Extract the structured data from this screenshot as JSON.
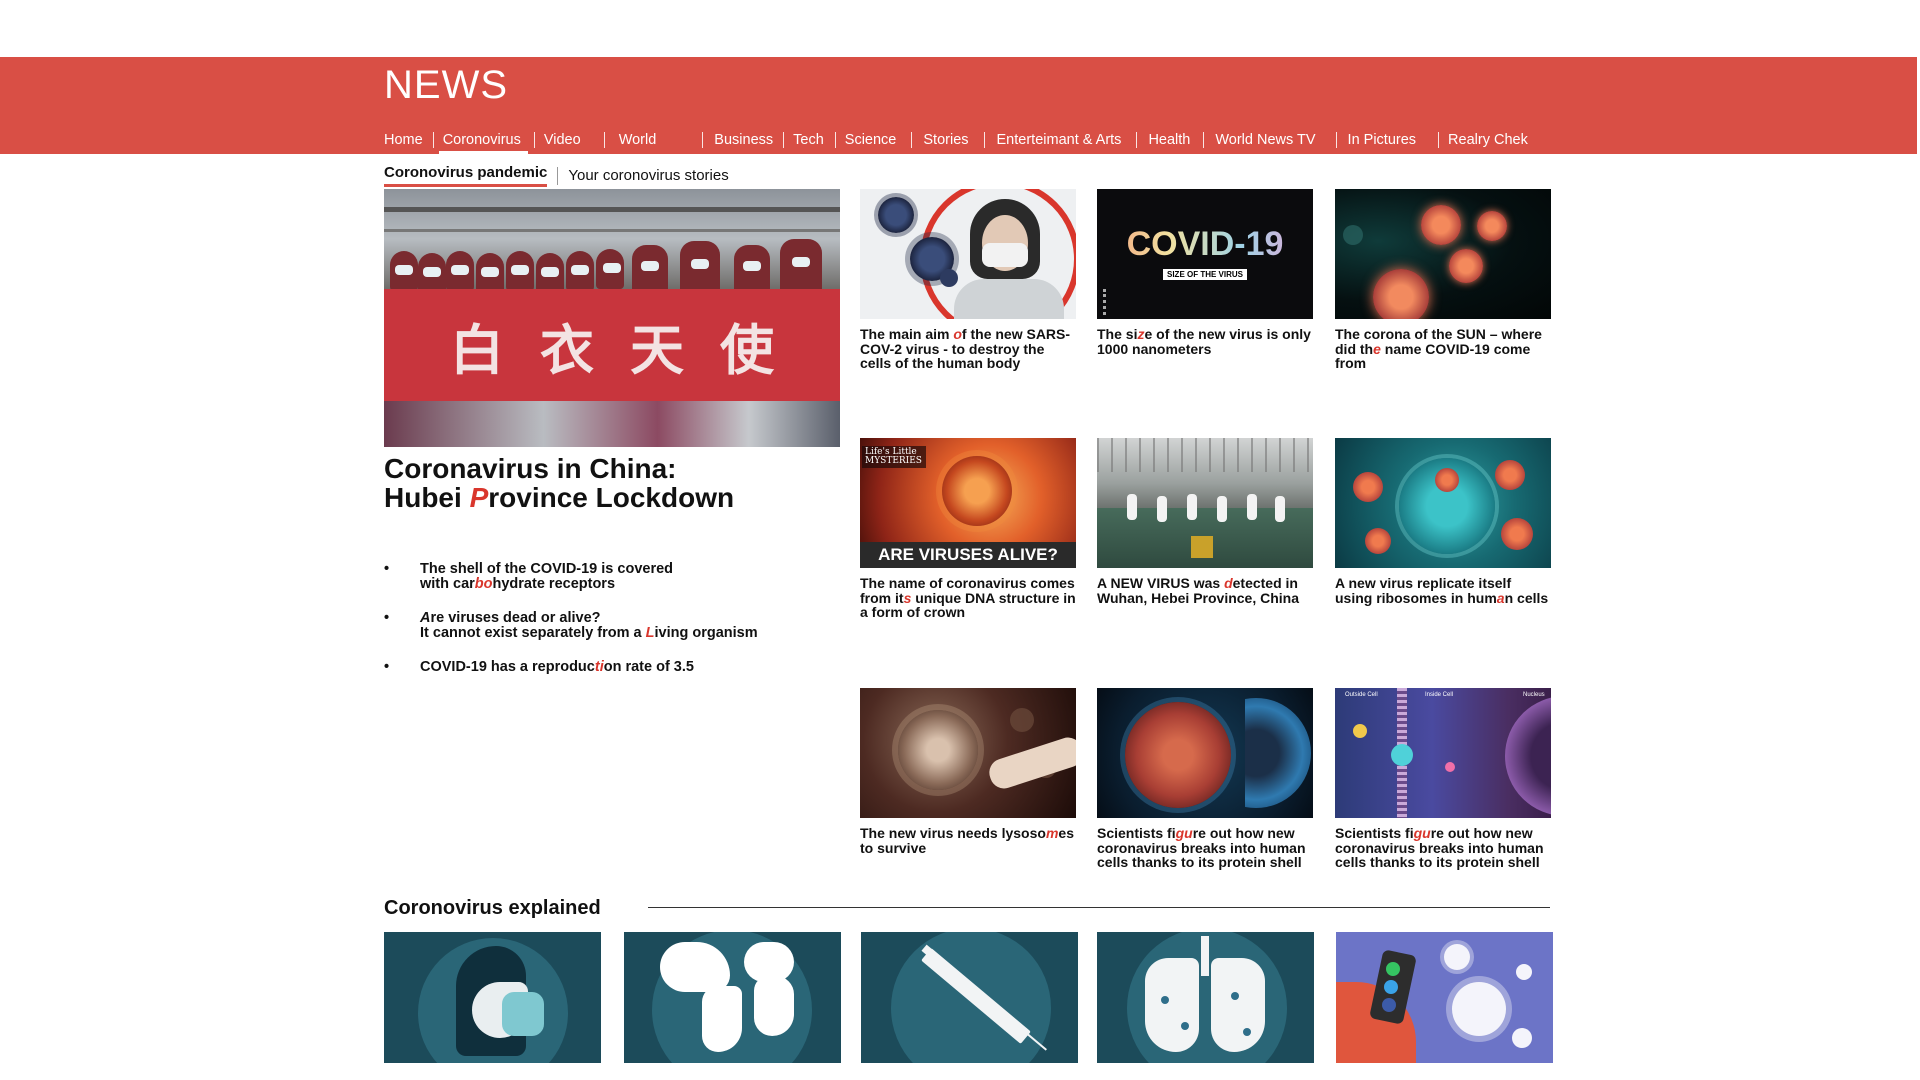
{
  "header": {
    "logo": "NEWS",
    "nav": [
      {
        "label": "Home"
      },
      {
        "label": "Coronovirus",
        "active": true
      },
      {
        "label": "Video"
      },
      {
        "label": "World"
      },
      {
        "label": "Business"
      },
      {
        "label": "Tech"
      },
      {
        "label": "Science"
      },
      {
        "label": "Stories"
      },
      {
        "label": "Enterteimant & Arts"
      },
      {
        "label": "Health"
      },
      {
        "label": "World News TV"
      },
      {
        "label": "In Pictures"
      },
      {
        "label": "Realry Chek"
      }
    ]
  },
  "subnav": {
    "tab_active": "Coronovirus pandemic",
    "tab_other": "Your coronovirus stories"
  },
  "hero": {
    "banner_text": "白衣天使",
    "title_line1": "Coronavirus in China:",
    "title_line2_pre": "Hubei ",
    "title_line2_hl": "P",
    "title_line2_post": "rovince Lockdown",
    "bullets": [
      {
        "line1_pre": "The shell of the COVID-19  is covered",
        "line2_pre": "with car",
        "hl": "bo",
        "line2_post": "hydrate receptors"
      },
      {
        "line1_hl": "A",
        "line1_post": "re viruses dead or alive?",
        "line2_pre": "It cannot exist separately from a ",
        "hl": "L",
        "line2_post": "iving organism"
      },
      {
        "pre": "COVID-19 has a reproduc",
        "hl": "ti",
        "post": "on rate of 3.5"
      }
    ]
  },
  "cards": [
    {
      "pre": "The main aim ",
      "hl": "o",
      "post": "f the new SARS-COV-2 virus  -  to destroy the cells of the human body"
    },
    {
      "pre": "The si",
      "hl": "z",
      "post": "e of the new virus is only 1000 nanometers",
      "thumb_title": "COVID-19",
      "thumb_sub": "SIZE OF THE VIRUS"
    },
    {
      "pre": "The corona of the SUN – where did th",
      "hl": "e",
      "post": " name COVID-19 come from"
    },
    {
      "pre": "The name of coronavirus comes from it",
      "hl": "s",
      "post": " unique DNA structure in a form of crown",
      "thumb_title": "ARE VIRUSES ALIVE?",
      "thumb_tag": "Life's Little MYSTERIES"
    },
    {
      "pre": "A NEW VIRUS was ",
      "hl": "d",
      "post": "etected in Wuhan, Hebei Province, China"
    },
    {
      "pre": "A new virus replicate itself using ribosomes in hum",
      "hl": "a",
      "post": "n cells"
    },
    {
      "pre": "The new virus needs lysoso",
      "hl": "m",
      "post": "es to survive"
    },
    {
      "pre": "Scientists fi",
      "hl": "gu",
      "post": "re out how new coronavirus breaks into human cells thanks to its protein shell"
    },
    {
      "pre": "Scientists fi",
      "hl": "gu",
      "post": "re out how new coronavirus breaks into human cells thanks to its protein shell",
      "thumb_labels": [
        "Outside Cell",
        "Inside Cell",
        "Nucleus"
      ]
    }
  ],
  "explained": {
    "title": "Coronovirus explained"
  },
  "colors": {
    "brand_red": "#d94f45",
    "highlight": "#d9362c",
    "teal_dark": "#1c4b5a"
  }
}
